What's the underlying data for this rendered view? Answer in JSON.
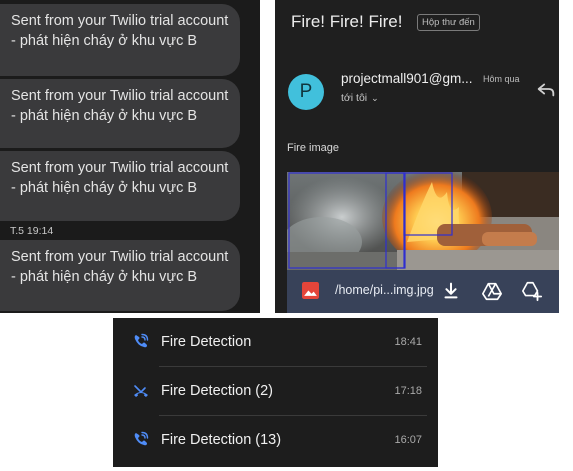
{
  "sms": {
    "messages": [
      {
        "text": "Sent from your Twilio trial account - phát hiện cháy ở khu vực B"
      },
      {
        "text": "Sent from your Twilio trial account - phát hiện cháy ở khu vực B"
      },
      {
        "text": "Sent from your Twilio trial account - phát hiện cháy ở khu vực B"
      },
      {
        "text": "Sent from your Twilio trial account - phát hiện cháy ở khu vực B"
      }
    ],
    "timestamp": "T.5 19:14"
  },
  "email": {
    "subject": "Fire! Fire! Fire!",
    "label": "Hộp thư đến",
    "sender": {
      "initial": "P",
      "name": "projectmall901@gm...",
      "time": "Hôm qua",
      "recipient": "tới tôi",
      "recipient_chevron": "⌄"
    },
    "body": "Fire image",
    "attachment": {
      "name": "/home/pi...img.jpg"
    },
    "colors": {
      "avatar": "#41c0dc",
      "attachment_bar": "#384259"
    },
    "icons": [
      "reply-icon",
      "image-file-icon",
      "download-icon",
      "drive-icon",
      "add-to-drive-icon"
    ]
  },
  "call_log": {
    "entries": [
      {
        "name": "Fire Detection",
        "time": "18:41",
        "type": "wifi-call-outgoing"
      },
      {
        "name": "Fire Detection (2)",
        "time": "17:18",
        "type": "missed"
      },
      {
        "name": "Fire Detection (13)",
        "time": "16:07",
        "type": "wifi-call-outgoing"
      }
    ],
    "colors": {
      "icon": "#4f8cf7"
    }
  }
}
